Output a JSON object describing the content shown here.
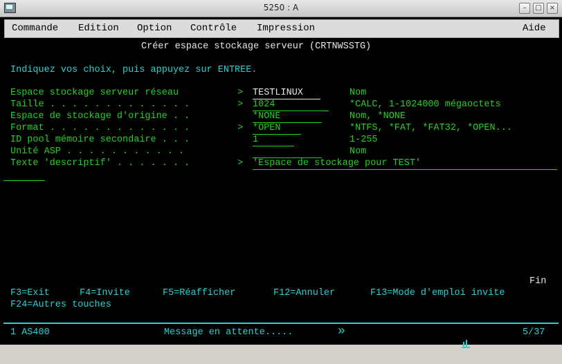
{
  "window": {
    "title": "5250 : A"
  },
  "menu": {
    "commande": "Commande",
    "edition": "Edition",
    "option": "Option",
    "controle": "Contrôle",
    "impression": "Impression",
    "aide": "Aide"
  },
  "screen": {
    "heading": "Créer espace stockage serveur (CRTNWSSTG)",
    "instruction": "Indiquez vos choix, puis appuyez sur ENTREE.",
    "fields": [
      {
        "label": "Espace stockage serveur réseau",
        "marker": ">",
        "value": "TESTLINUX",
        "hint": "Nom"
      },
      {
        "label": "Taille . . . . . . . . . . . . .",
        "marker": ">",
        "value": "1024",
        "hint": "*CALC, 1-1024000 mégaoctets"
      },
      {
        "label": "Espace de stockage d'origine . .",
        "marker": "",
        "value": "*NONE",
        "hint": "Nom, *NONE"
      },
      {
        "label": "Format . . . . . . . . . . . . .",
        "marker": ">",
        "value": "*OPEN",
        "hint": "*NTFS, *FAT, *FAT32, *OPEN..."
      },
      {
        "label": "ID pool mémoire secondaire . . .",
        "marker": "",
        "value": "1",
        "hint": "1-255"
      },
      {
        "label": "Unité ASP . . . . . . . . . . .",
        "marker": "",
        "value": "",
        "hint": "Nom"
      },
      {
        "label": "Texte 'descriptif' . . . . . . .",
        "marker": ">",
        "value": "'Espace de stockage pour TEST'",
        "hint": ""
      }
    ],
    "end_marker": "Fin",
    "function_keys": {
      "f3": "F3=Exit",
      "f4": "F4=Invite",
      "f5": "F5=Réafficher",
      "f12": "F12=Annuler",
      "f13": "F13=Mode d'emploi invite",
      "f24": "F24=Autres touches"
    }
  },
  "status": {
    "session": "1 AS400",
    "message": "Message en attente.....",
    "arrow": "»",
    "position": "5/37"
  },
  "colors": {
    "cyan": "#27d3d3",
    "green": "#27d027",
    "white": "#e8e8e8",
    "background": "#000000"
  }
}
